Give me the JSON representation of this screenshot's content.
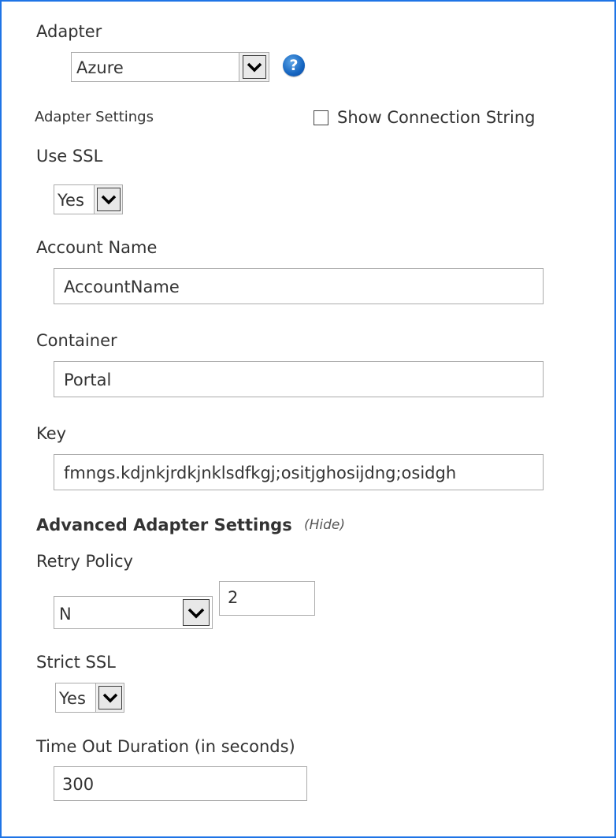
{
  "adapter": {
    "label": "Adapter",
    "selected": "Azure"
  },
  "adapter_settings": {
    "label": "Adapter Settings",
    "show_connection_string_label": "Show Connection String",
    "show_connection_string_checked": false
  },
  "use_ssl": {
    "label": "Use SSL",
    "selected": "Yes"
  },
  "account_name": {
    "label": "Account Name",
    "value": "AccountName"
  },
  "container": {
    "label": "Container",
    "value": "Portal"
  },
  "key": {
    "label": "Key",
    "value": "fmngs.kdjnkjrdkjnklsdfkgj;ositjghosijdng;osidgh"
  },
  "advanced": {
    "title": "Advanced Adapter Settings",
    "toggle_label": "(Hide)"
  },
  "retry_policy": {
    "label": "Retry Policy",
    "selected": "N",
    "count_value": "2"
  },
  "strict_ssl": {
    "label": "Strict SSL",
    "selected": "Yes"
  },
  "timeout": {
    "label": "Time Out Duration (in seconds)",
    "value": "300"
  },
  "icons": {
    "help": "help-icon",
    "dropdown": "chevron-down-icon"
  },
  "colors": {
    "frame_border": "#1e74e6",
    "help_icon": "#1565c0"
  }
}
